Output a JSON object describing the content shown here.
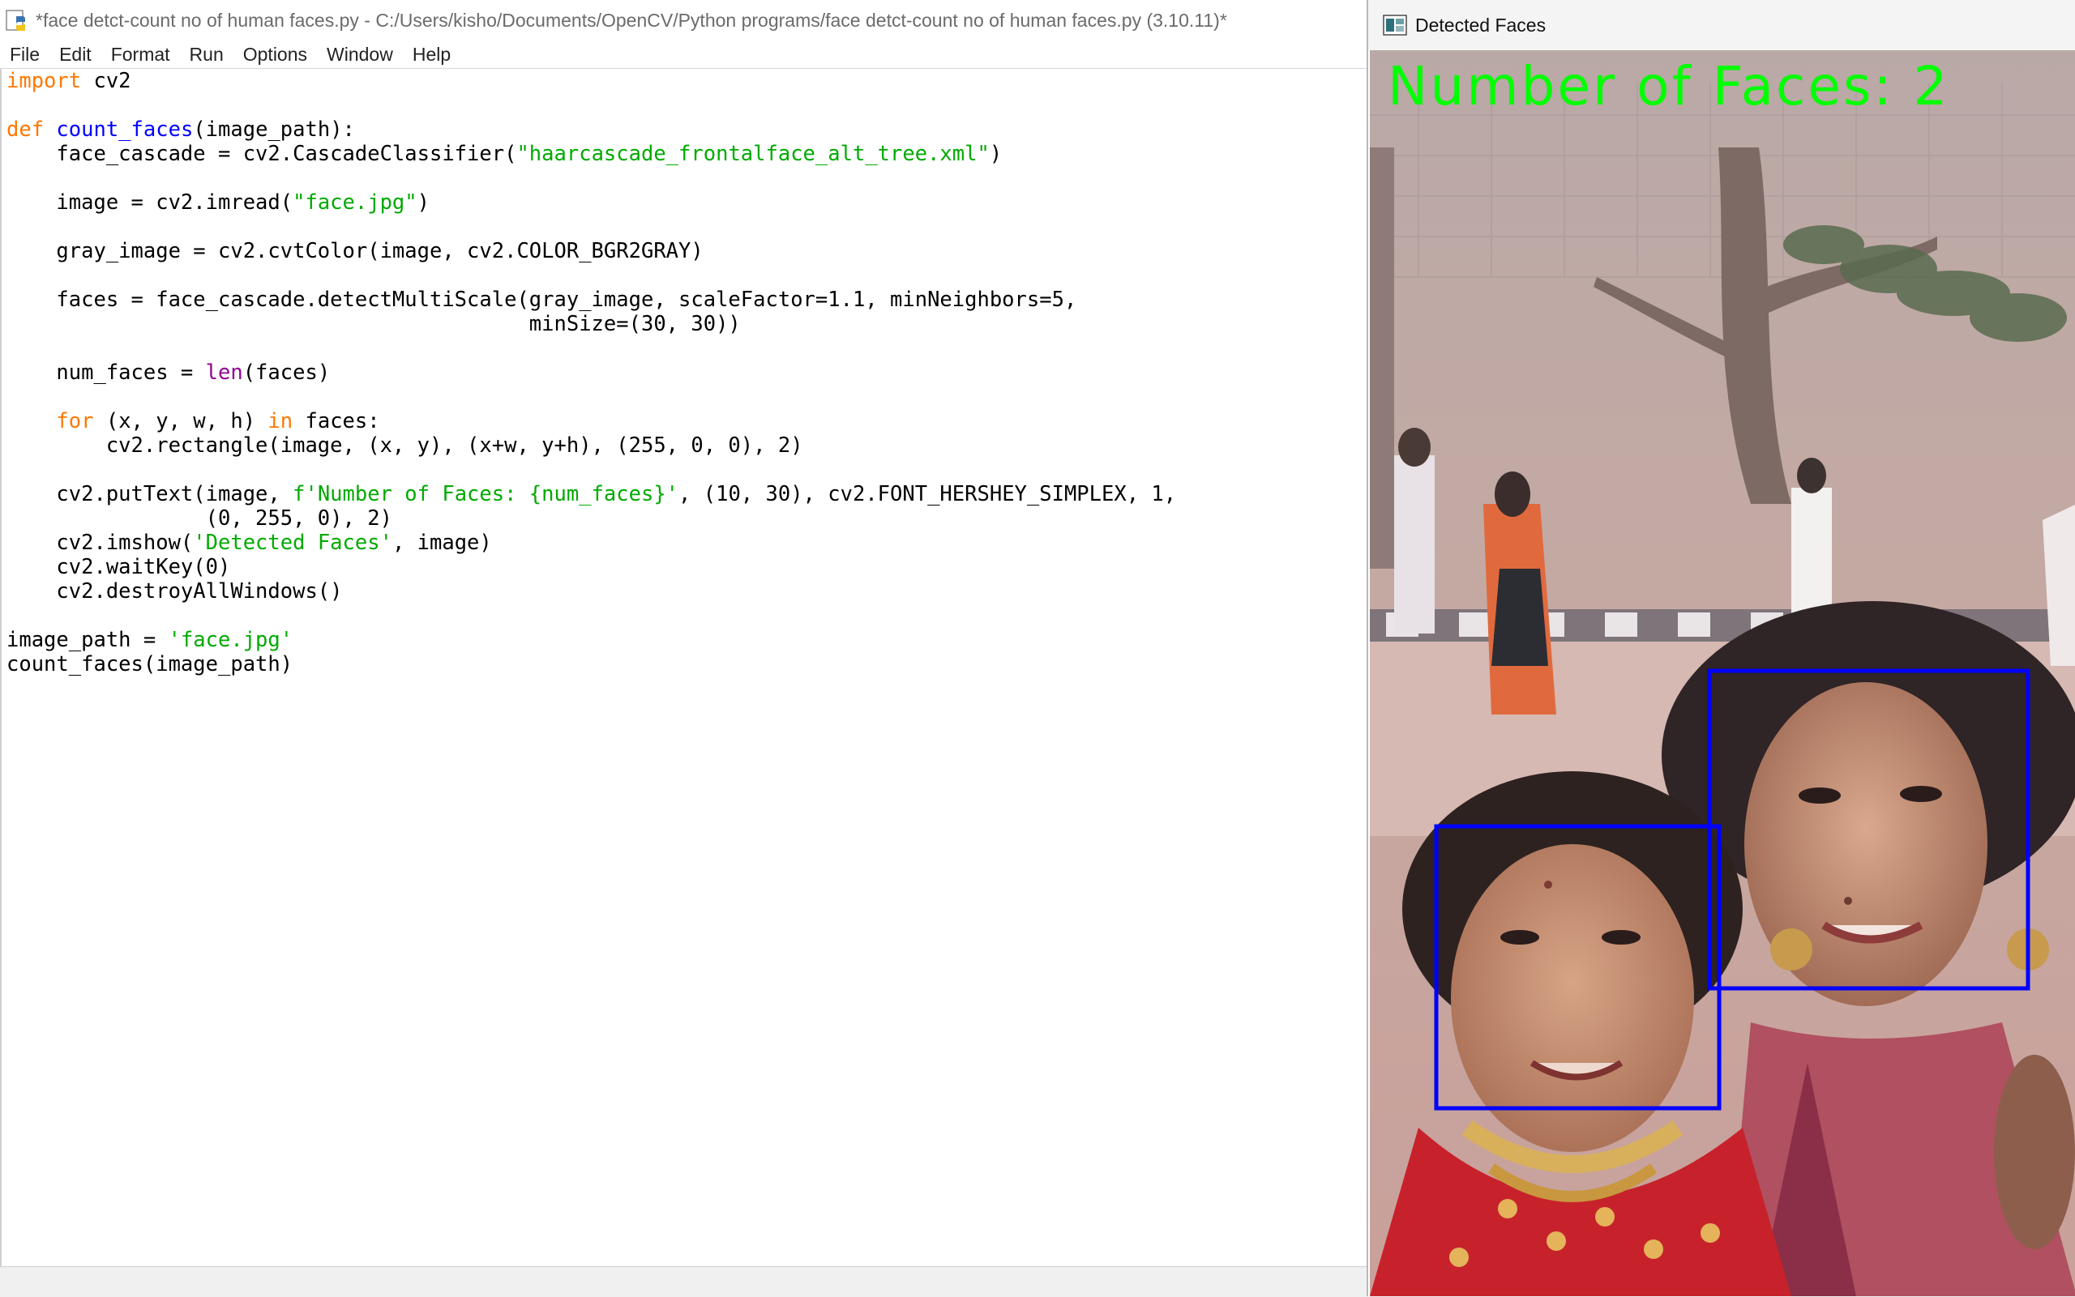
{
  "idle": {
    "title": "*face detct-count no of human faces.py - C:/Users/kisho/Documents/OpenCV/Python programs/face detct-count no of human faces.py (3.10.11)*",
    "app_icon": "python-idle-icon",
    "menu": [
      "File",
      "Edit",
      "Format",
      "Run",
      "Options",
      "Window",
      "Help"
    ]
  },
  "code_lines": [
    [
      {
        "t": "import",
        "c": "kw"
      },
      {
        "t": " cv2"
      }
    ],
    [],
    [
      {
        "t": "def",
        "c": "kw"
      },
      {
        "t": " "
      },
      {
        "t": "count_faces",
        "c": "def"
      },
      {
        "t": "(image_path):"
      }
    ],
    [
      {
        "t": "    face_cascade = cv2.CascadeClassifier("
      },
      {
        "t": "\"haarcascade_frontalface_alt_tree.xml\"",
        "c": "str"
      },
      {
        "t": ")"
      }
    ],
    [],
    [
      {
        "t": "    image = cv2.imread("
      },
      {
        "t": "\"face.jpg\"",
        "c": "str"
      },
      {
        "t": ")"
      }
    ],
    [],
    [
      {
        "t": "    gray_image = cv2.cvtColor(image, cv2.COLOR_BGR2GRAY)"
      }
    ],
    [],
    [
      {
        "t": "    faces = face_cascade.detectMultiScale(gray_image, scaleFactor=1.1, minNeighbors=5,"
      }
    ],
    [
      {
        "t": "                                          minSize=(30, 30))"
      }
    ],
    [],
    [
      {
        "t": "    num_faces = "
      },
      {
        "t": "len",
        "c": "bi"
      },
      {
        "t": "(faces)"
      }
    ],
    [],
    [
      {
        "t": "    "
      },
      {
        "t": "for",
        "c": "kw"
      },
      {
        "t": " (x, y, w, h) "
      },
      {
        "t": "in",
        "c": "kw"
      },
      {
        "t": " faces:"
      }
    ],
    [
      {
        "t": "        cv2.rectangle(image, (x, y), (x+w, y+h), (255, 0, 0), 2)"
      }
    ],
    [],
    [
      {
        "t": "    cv2.putText(image, "
      },
      {
        "t": "f'Number of Faces: {num_faces}'",
        "c": "str"
      },
      {
        "t": ", (10, 30), cv2.FONT_HERSHEY_SIMPLEX, 1,"
      }
    ],
    [
      {
        "t": "                (0, 255, 0), 2)"
      }
    ],
    [
      {
        "t": "    cv2.imshow("
      },
      {
        "t": "'Detected Faces'",
        "c": "str"
      },
      {
        "t": ", image)"
      }
    ],
    [
      {
        "t": "    cv2.waitKey(0)"
      }
    ],
    [
      {
        "t": "    cv2.destroyAllWindows()"
      }
    ],
    [],
    [
      {
        "t": "image_path = "
      },
      {
        "t": "'face.jpg'",
        "c": "str"
      }
    ],
    [
      {
        "t": "count_faces(image_path)"
      }
    ]
  ],
  "syntax_colors": {
    "keyword": "#ff7700",
    "definition": "#0000ff",
    "builtin": "#900090",
    "string": "#00aa00"
  },
  "cv": {
    "title": "Detected Faces",
    "app_icon": "opencv-window-icon",
    "overlay_text": "Number of Faces: 2",
    "overlay_color": "#00ff00",
    "face_box_color": "#0000ff",
    "detected_faces": 2
  }
}
